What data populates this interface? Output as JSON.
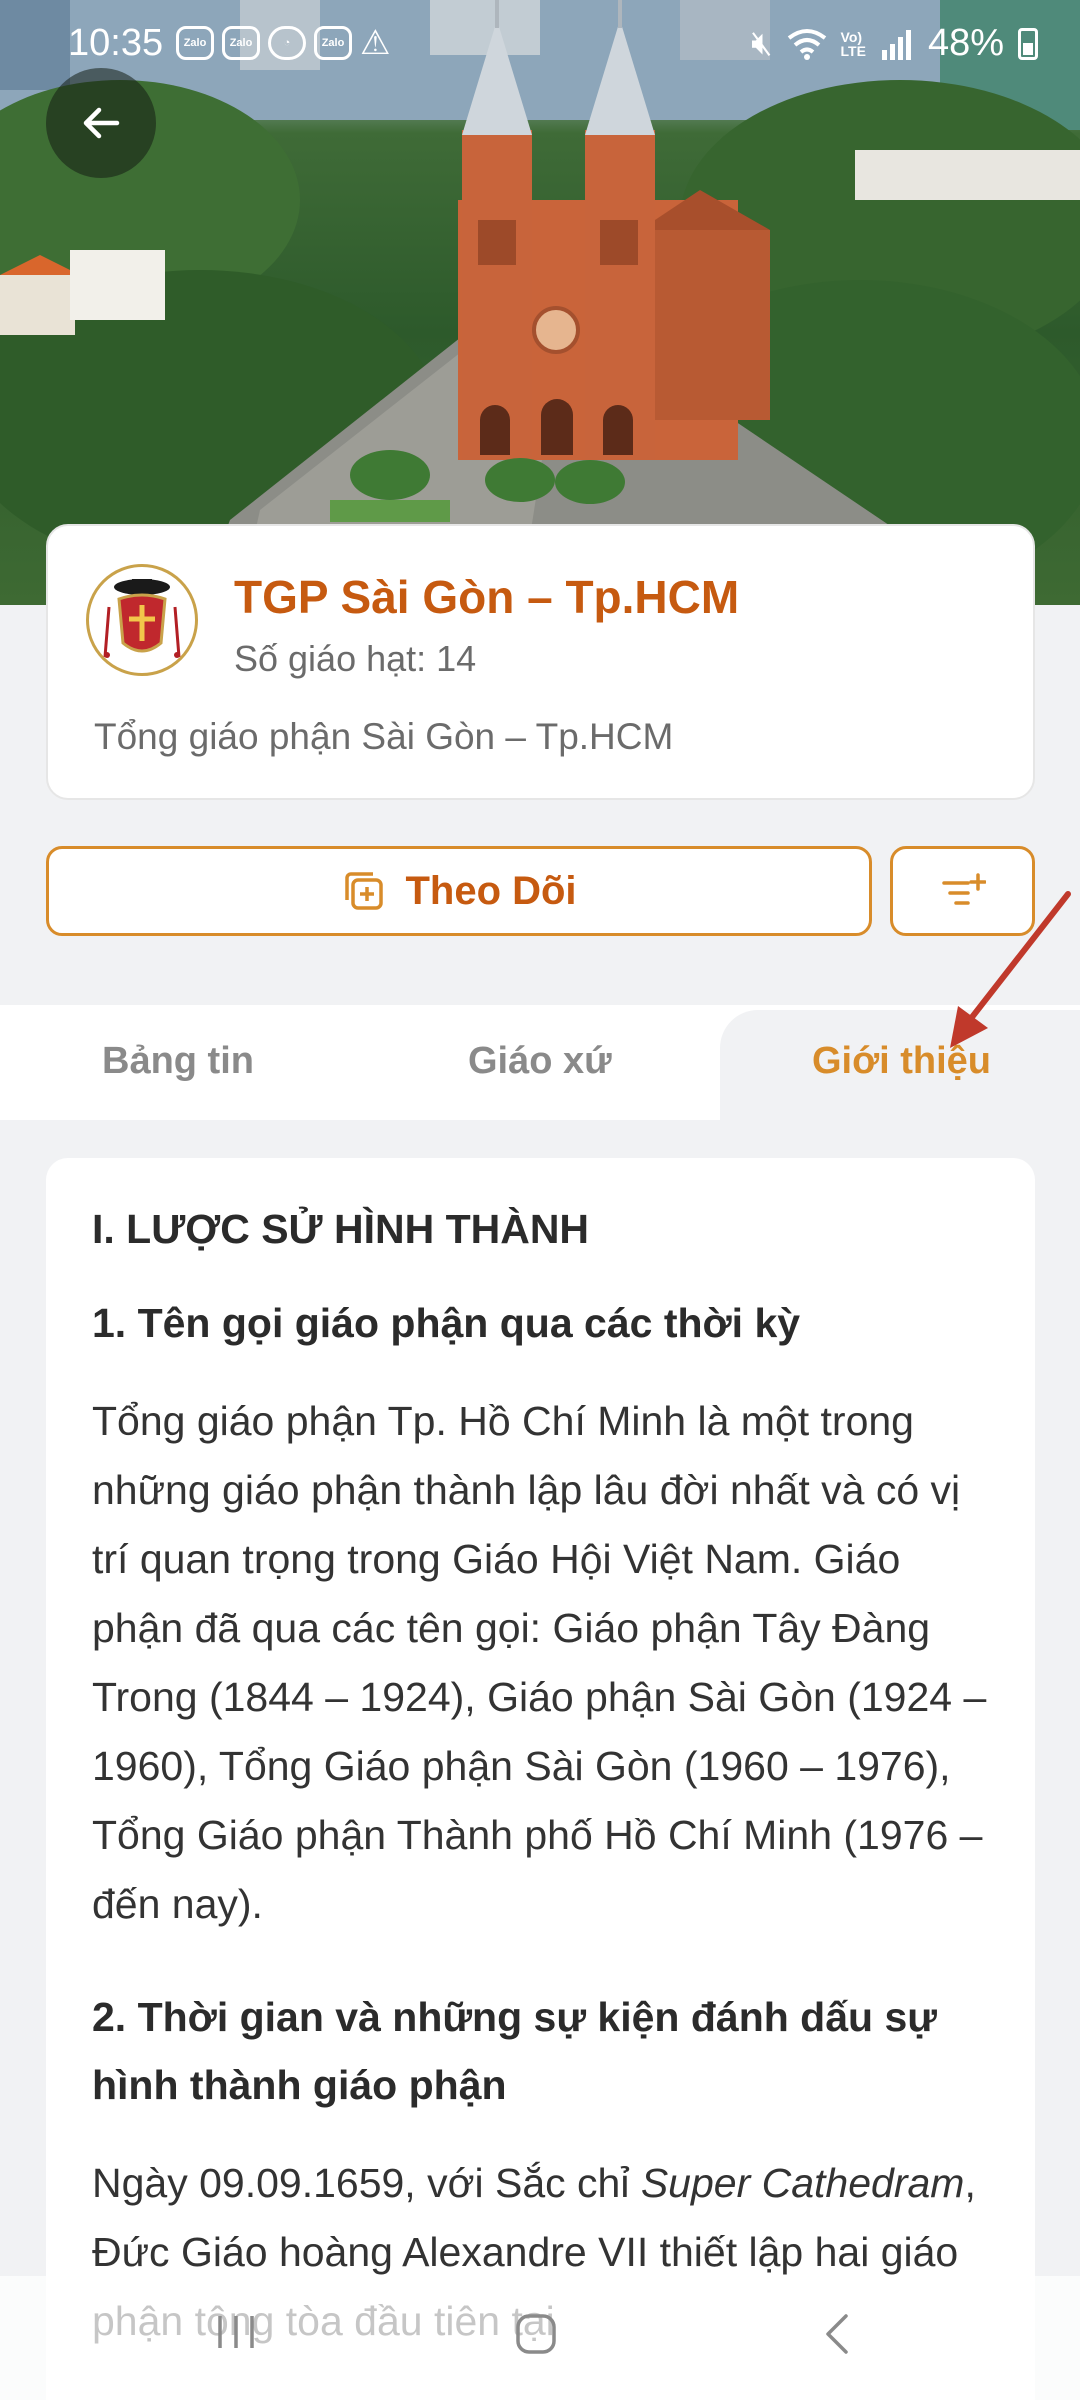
{
  "status_bar": {
    "time": "10:35",
    "app_icons": [
      "Zalo",
      "Zalo",
      "whatsapp",
      "Zalo",
      "warning"
    ],
    "battery": "48%"
  },
  "header": {
    "org_name": "TGP Sài Gòn – Tp.HCM",
    "deanery_count": "Số giáo hạt: 14",
    "description": "Tổng giáo phận Sài Gòn – Tp.HCM"
  },
  "actions": {
    "follow_label": "Theo Dõi"
  },
  "tabs": [
    {
      "label": "Bảng tin",
      "active": false
    },
    {
      "label": "Giáo xứ",
      "active": false
    },
    {
      "label": "Giới thiệu",
      "active": true
    }
  ],
  "content": {
    "section_title": "I. LƯỢC SỬ HÌNH THÀNH",
    "sub1_title": "1. Tên gọi giáo phận qua các thời kỳ",
    "sub1_body": "Tổng giáo phận Tp. Hồ Chí Minh là một trong những giáo phận thành lập lâu đời nhất và có vị trí quan trọng trong Giáo Hội Việt Nam. Giáo phận đã qua các tên gọi: Giáo phận Tây Đàng Trong (1844 – 1924), Giáo phận Sài Gòn (1924 – 1960), Tổng Giáo phận Sài Gòn (1960 – 1976), Tổng Giáo phận Thành phố Hồ Chí Minh (1976 – đến nay).",
    "sub2_title": "2. Thời gian và những sự kiện đánh dấu sự hình thành giáo phận",
    "sub2_body_start": "Ngày 09.09.1659, với Sắc chỉ ",
    "sub2_body_italic": "Super Cathedram",
    "sub2_body_rest": ", Đức Giáo hoàng Alexandre VII thiết lập hai giáo phận tông tòa đầu tiên tại"
  },
  "colors": {
    "accent": "#d88c2a",
    "brand_text": "#c65a10",
    "annotation_arrow": "#c0392b"
  }
}
